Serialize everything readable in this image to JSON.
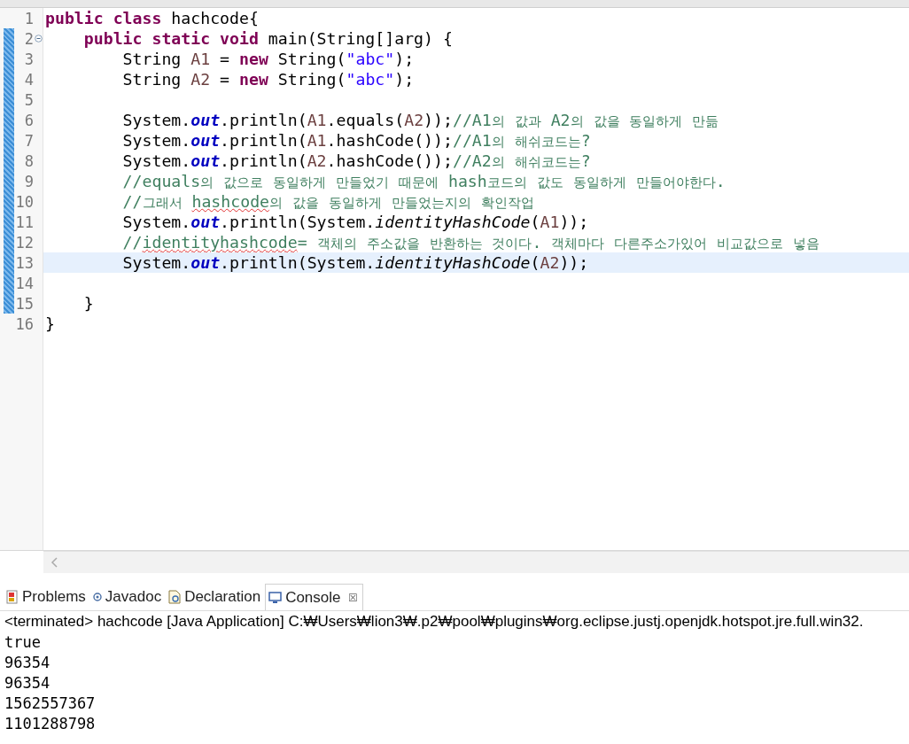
{
  "editor": {
    "lines": [
      {
        "number": "1",
        "changed": false,
        "fold": false,
        "current": false,
        "tokens": [
          {
            "kind": "kw",
            "text": "public class"
          },
          {
            "kind": "plain",
            "text": " hachcode{"
          }
        ]
      },
      {
        "number": "2",
        "changed": true,
        "fold": true,
        "current": false,
        "tokens": [
          {
            "kind": "kw",
            "text": "    public static void"
          },
          {
            "kind": "plain",
            "text": " main(String[]arg) {"
          }
        ]
      },
      {
        "number": "3",
        "changed": true,
        "fold": false,
        "current": false,
        "tokens": [
          {
            "kind": "plain",
            "text": "        String "
          },
          {
            "kind": "var",
            "text": "A1"
          },
          {
            "kind": "plain",
            "text": " = "
          },
          {
            "kind": "kw",
            "text": "new"
          },
          {
            "kind": "plain",
            "text": " String("
          },
          {
            "kind": "str",
            "text": "\"abc\""
          },
          {
            "kind": "plain",
            "text": ");"
          }
        ]
      },
      {
        "number": "4",
        "changed": true,
        "fold": false,
        "current": false,
        "tokens": [
          {
            "kind": "plain",
            "text": "        String "
          },
          {
            "kind": "var",
            "text": "A2"
          },
          {
            "kind": "plain",
            "text": " = "
          },
          {
            "kind": "kw",
            "text": "new"
          },
          {
            "kind": "plain",
            "text": " String("
          },
          {
            "kind": "str",
            "text": "\"abc\""
          },
          {
            "kind": "plain",
            "text": ");"
          }
        ]
      },
      {
        "number": "5",
        "changed": true,
        "fold": false,
        "current": false
      },
      {
        "number": "6",
        "changed": true,
        "fold": false,
        "current": false,
        "tokens": [
          {
            "kind": "plain",
            "text": "        System."
          },
          {
            "kind": "field",
            "text": "out"
          },
          {
            "kind": "plain",
            "text": ".println("
          },
          {
            "kind": "var",
            "text": "A1"
          },
          {
            "kind": "plain",
            "text": ".equals("
          },
          {
            "kind": "var",
            "text": "A2"
          },
          {
            "kind": "plain",
            "text": "));"
          },
          {
            "kind": "comment",
            "text": "//A1의 값과 A2의 값을 동일하게 만듦"
          }
        ]
      },
      {
        "number": "7",
        "changed": true,
        "fold": false,
        "current": false,
        "tokens": [
          {
            "kind": "plain",
            "text": "        System."
          },
          {
            "kind": "field",
            "text": "out"
          },
          {
            "kind": "plain",
            "text": ".println("
          },
          {
            "kind": "var",
            "text": "A1"
          },
          {
            "kind": "plain",
            "text": ".hashCode());"
          },
          {
            "kind": "comment",
            "text": "//A1의 해쉬코드는?"
          }
        ]
      },
      {
        "number": "8",
        "changed": true,
        "fold": false,
        "current": false,
        "tokens": [
          {
            "kind": "plain",
            "text": "        System."
          },
          {
            "kind": "field",
            "text": "out"
          },
          {
            "kind": "plain",
            "text": ".println("
          },
          {
            "kind": "var",
            "text": "A2"
          },
          {
            "kind": "plain",
            "text": ".hashCode());"
          },
          {
            "kind": "comment",
            "text": "//A2의 해쉬코드는?"
          }
        ]
      },
      {
        "number": "9",
        "changed": true,
        "fold": false,
        "current": false,
        "tokens": [
          {
            "kind": "comment",
            "text": "        //equals의 값으로 동일하게 만들었기 때문에 hash코드의 값도 동일하게 만들어야한다."
          }
        ]
      },
      {
        "number": "10",
        "changed": true,
        "fold": false,
        "current": false,
        "tokens": [
          {
            "kind": "comment",
            "text": "        //그래서 "
          },
          {
            "kind": "comment-typo",
            "text": "hashcode"
          },
          {
            "kind": "comment",
            "text": "의 값을 동일하게 만들었는지의 확인작업"
          }
        ]
      },
      {
        "number": "11",
        "changed": true,
        "fold": false,
        "current": false,
        "tokens": [
          {
            "kind": "plain",
            "text": "        System."
          },
          {
            "kind": "field",
            "text": "out"
          },
          {
            "kind": "plain",
            "text": ".println(System."
          },
          {
            "kind": "static",
            "text": "identityHashCode"
          },
          {
            "kind": "plain",
            "text": "("
          },
          {
            "kind": "var",
            "text": "A1"
          },
          {
            "kind": "plain",
            "text": "));"
          }
        ]
      },
      {
        "number": "12",
        "changed": true,
        "fold": false,
        "current": false,
        "tokens": [
          {
            "kind": "comment",
            "text": "        //"
          },
          {
            "kind": "comment-typo",
            "text": "identityhashcode"
          },
          {
            "kind": "comment",
            "text": "= 객체의 주소값을 반환하는 것이다. 객체마다 다른주소가있어 비교값으로 넣음"
          }
        ]
      },
      {
        "number": "13",
        "changed": true,
        "fold": false,
        "current": true,
        "tokens": [
          {
            "kind": "plain",
            "text": "        System."
          },
          {
            "kind": "field",
            "text": "out"
          },
          {
            "kind": "plain",
            "text": ".println(System."
          },
          {
            "kind": "static",
            "text": "identityHashCode"
          },
          {
            "kind": "plain",
            "text": "("
          },
          {
            "kind": "var",
            "text": "A2"
          },
          {
            "kind": "plain",
            "text": "));"
          }
        ]
      },
      {
        "number": "14",
        "changed": true,
        "fold": false,
        "current": false
      },
      {
        "number": "15",
        "changed": true,
        "fold": false,
        "current": false,
        "tokens": [
          {
            "kind": "plain",
            "text": "    }"
          }
        ]
      },
      {
        "number": "16",
        "changed": false,
        "fold": false,
        "current": false,
        "tokens": [
          {
            "kind": "plain",
            "text": "}"
          }
        ]
      }
    ]
  },
  "panel": {
    "tabs": [
      {
        "kind": "problems",
        "label": "Problems",
        "selected": false
      },
      {
        "kind": "javadoc",
        "label": "Javadoc",
        "selected": false
      },
      {
        "kind": "declaration",
        "label": "Declaration",
        "selected": false
      },
      {
        "kind": "console",
        "label": "Console",
        "selected": true
      }
    ],
    "close": "☒",
    "status": "<terminated> hachcode [Java Application] C:₩Users₩lion3₩.p2₩pool₩plugins₩org.eclipse.justj.openjdk.hotspot.jre.full.win32.",
    "output": [
      "true",
      "96354",
      "96354",
      "1562557367",
      "1101288798"
    ]
  }
}
